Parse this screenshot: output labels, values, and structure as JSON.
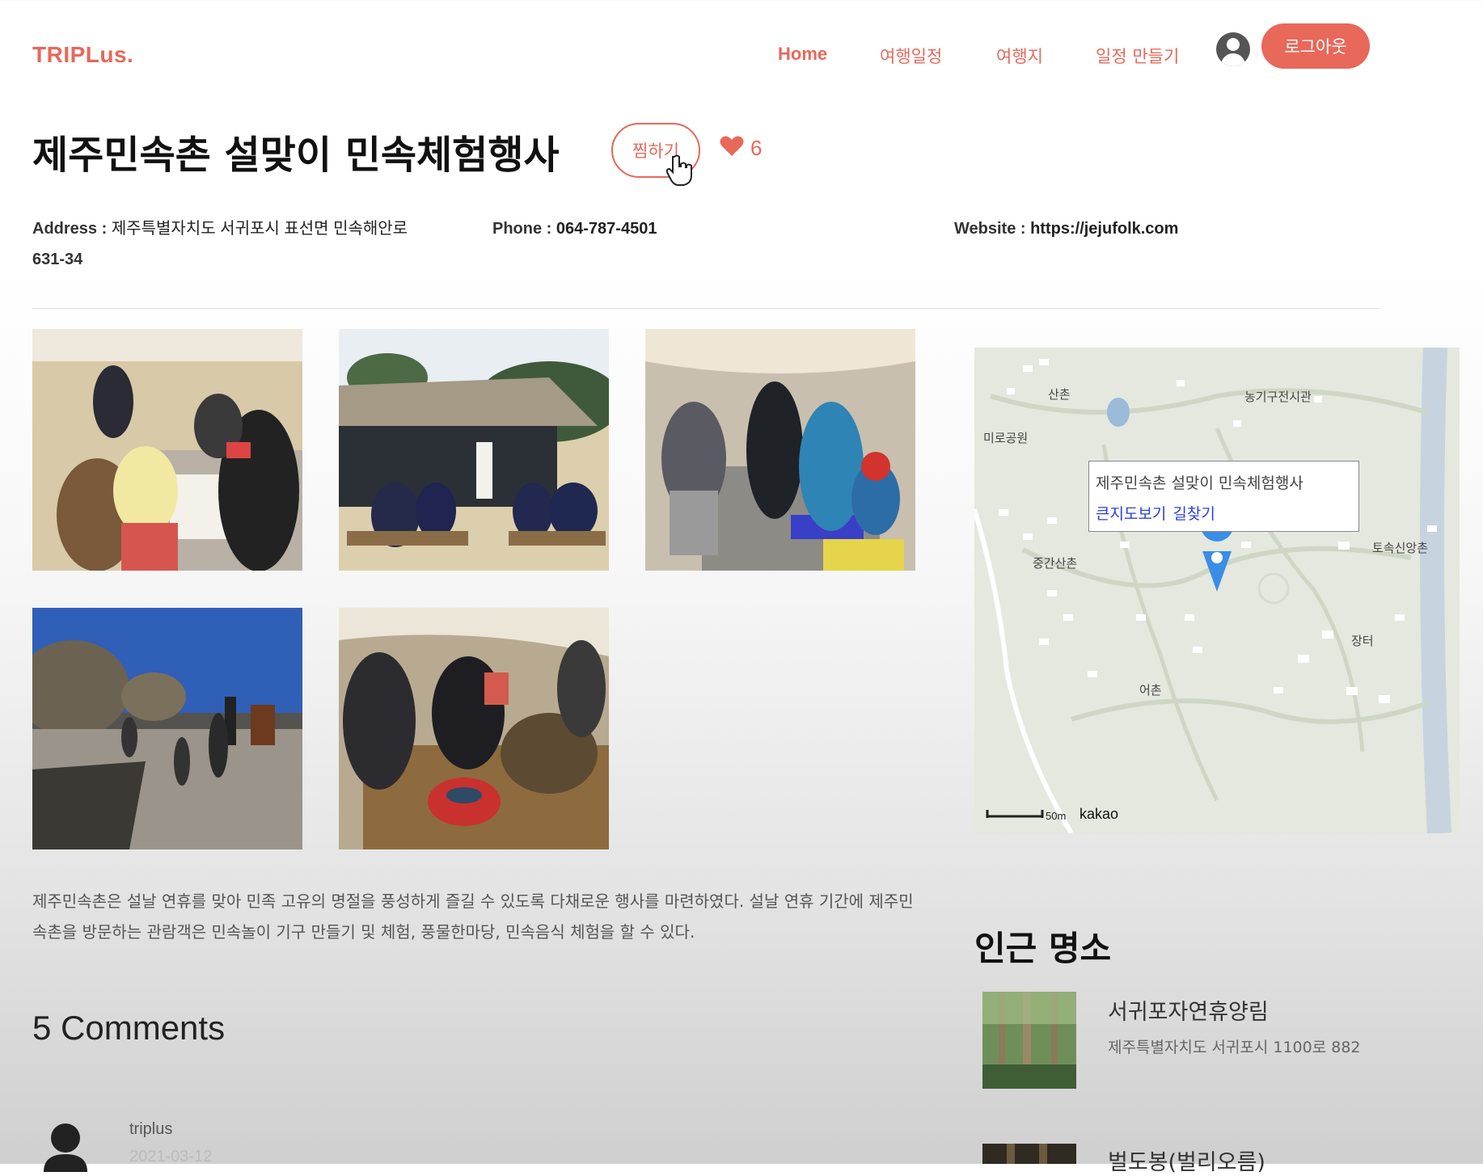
{
  "header": {
    "logo": "TRIPLus.",
    "nav": [
      "Home",
      "여행일정",
      "여행지",
      "일정 만들기"
    ],
    "logout_label": "로그아웃",
    "accent_color": "#e8685a"
  },
  "place": {
    "title": "제주민속촌 설맞이 민속체험행사",
    "favorite_label": "찜하기",
    "like_count": "6",
    "address_label": "Address : ",
    "address_value_line1": "제주특별자치도 서귀포시 표선면 민속해안로",
    "address_value_line2": "631-34",
    "phone_label": "Phone : ",
    "phone_value": "064-787-4501",
    "website_label": "Website : ",
    "website_value": "https://jejufolk.com",
    "description": "제주민속촌은 설날 연휴를 맞아 민족 고유의 명절을 풍성하게 즐길 수 있도록 다채로운 행사를 마련하였다. 설날 연휴 기간에 제주민속촌을 방문하는 관람객은 민속놀이 기구 만들기 및 체험, 풍물한마당, 민속음식 체험을 할 수 있다."
  },
  "map": {
    "labels": [
      "산촌",
      "농기구전시관",
      "미로공원",
      "중간산촌",
      "토속신앙촌",
      "장터",
      "어촌"
    ],
    "info_title": "제주민속촌 설맞이 민속체험행사",
    "info_link_map": "큰지도보기",
    "info_link_route": "길찾기",
    "scale_label": "50m",
    "brand": "kakao"
  },
  "comments": {
    "heading": "5 Comments",
    "first_author": "triplus",
    "first_date": "2021-03-12"
  },
  "nearby": {
    "heading": "인근 명소",
    "items": [
      {
        "name": "서귀포자연휴양림",
        "address": "제주특별자치도 서귀포시 1100로 882"
      },
      {
        "name": "벌도봉(벌리오름)",
        "address": ""
      }
    ]
  }
}
